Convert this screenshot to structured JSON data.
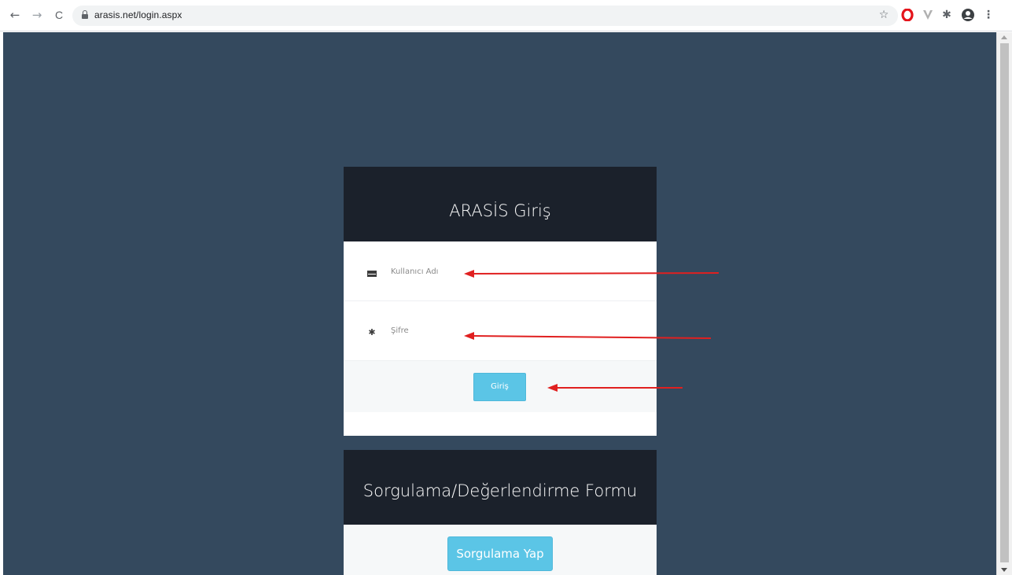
{
  "browser": {
    "back_icon": "←",
    "forward_icon": "→",
    "reload_icon": "C",
    "url": "arasis.net/login.aspx",
    "extensions": [
      "star-icon",
      "opera-icon",
      "vpn-icon",
      "puzzle-icon",
      "profile-icon",
      "menu-icon"
    ]
  },
  "login": {
    "title": "ARASİS Giriş",
    "username_placeholder": "Kullanıcı Adı",
    "password_placeholder": "Şifre",
    "submit_label": "Giriş"
  },
  "query": {
    "title": "Sorgulama/Değerlendirme Formu",
    "button_label": "Sorgulama Yap"
  },
  "colors": {
    "page_background": "#34495e",
    "card_header": "#1b212b",
    "button": "#5bc5e6",
    "annotation_arrow": "#e02020"
  }
}
